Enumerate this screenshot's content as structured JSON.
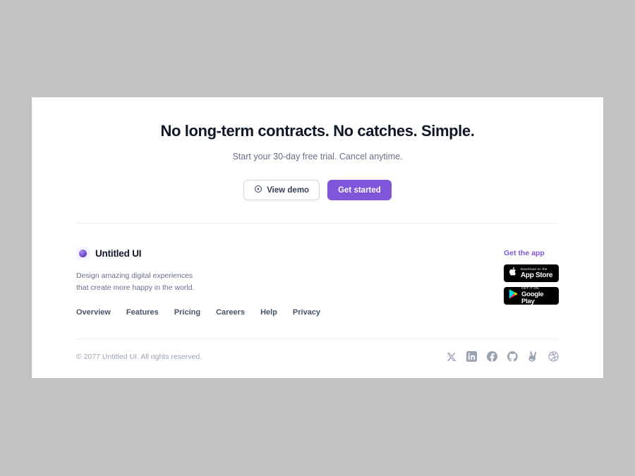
{
  "theme": {
    "page_background": "#c2c2c2",
    "card_background": "#ffffff",
    "accent": "#7f56d9",
    "heading_color": "#101828",
    "muted_text": "#667085",
    "divider": "#eaecf0"
  },
  "cta": {
    "title": "No long-term contracts. No catches. Simple.",
    "subtitle": "Start your 30-day free trial. Cancel anytime.",
    "secondary_button": {
      "label": "View demo",
      "icon": "play-circle-icon"
    },
    "primary_button": {
      "label": "Get started"
    }
  },
  "footer": {
    "brand": {
      "name": "Untitled UI",
      "logo_icon": "untitled-ui-logo-icon",
      "tagline": "Design amazing digital experiences that create more happy in the world."
    },
    "nav_links": [
      {
        "label": "Overview"
      },
      {
        "label": "Features"
      },
      {
        "label": "Pricing"
      },
      {
        "label": "Careers"
      },
      {
        "label": "Help"
      },
      {
        "label": "Privacy"
      }
    ],
    "app": {
      "label": "Get the app",
      "badges": [
        {
          "icon": "apple-icon",
          "small_text": "Download on the",
          "big_text": "App Store"
        },
        {
          "icon": "google-play-icon",
          "small_text": "GET IT ON",
          "big_text": "Google Play"
        }
      ]
    },
    "bottom": {
      "copyright": "© 2077 Untitled UI. All rights reserved.",
      "social": [
        {
          "name": "x-twitter-icon"
        },
        {
          "name": "linkedin-icon"
        },
        {
          "name": "facebook-icon"
        },
        {
          "name": "github-icon"
        },
        {
          "name": "angellist-icon"
        },
        {
          "name": "dribbble-icon"
        }
      ]
    }
  }
}
